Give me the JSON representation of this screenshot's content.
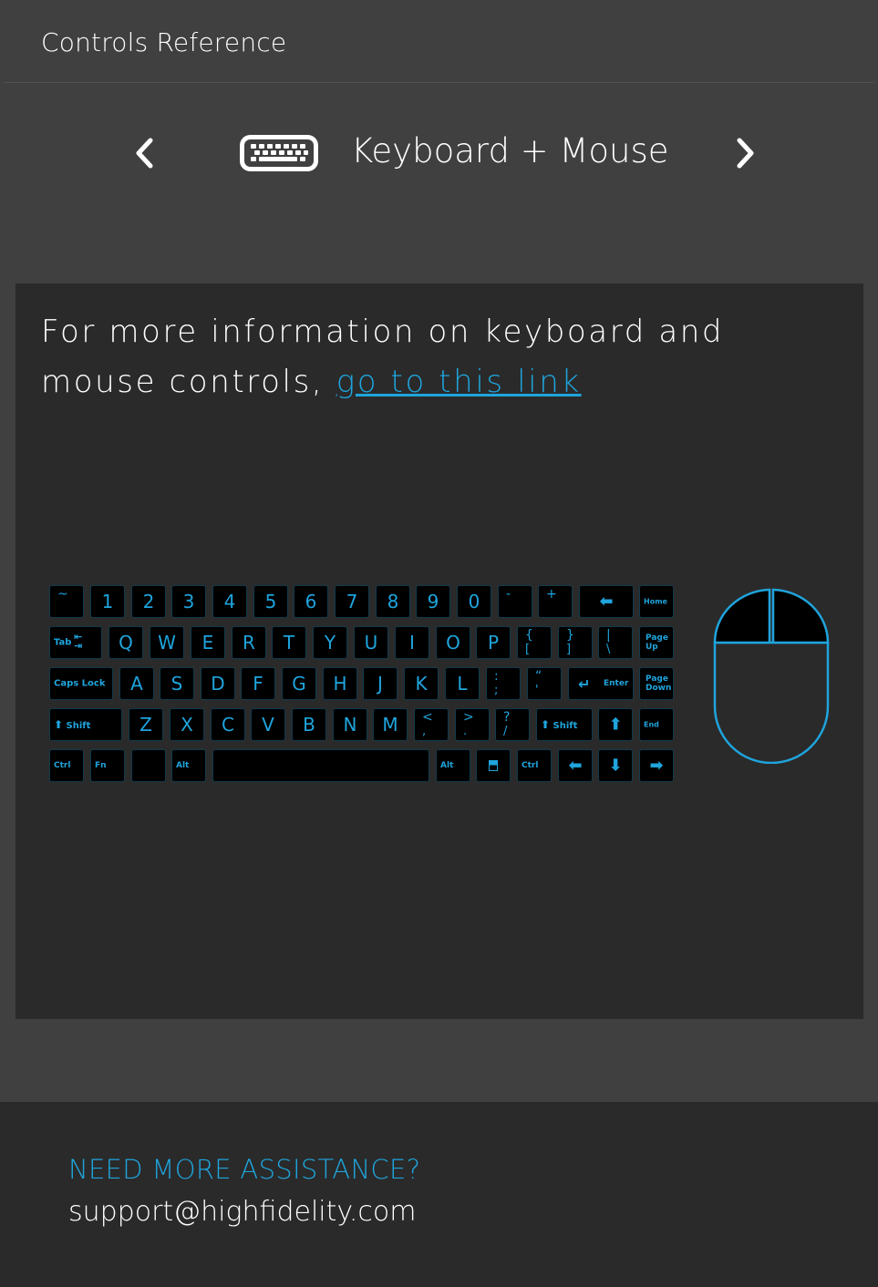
{
  "header": {
    "title": "Controls Reference"
  },
  "nav": {
    "prev_icon": "chevron-left-icon",
    "next_icon": "chevron-right-icon"
  },
  "scheme": {
    "icon": "keyboard-icon",
    "title": "Keyboard + Mouse"
  },
  "info": {
    "text": "For more information on keyboard and mouse controls, ",
    "link_text": "go to this link"
  },
  "keyboard": {
    "accent_color": "#1fa4dc",
    "keys": {
      "tilde": "~",
      "n1": "1",
      "n2": "2",
      "n3": "3",
      "n4": "4",
      "n5": "5",
      "n6": "6",
      "n7": "7",
      "n8": "8",
      "n9": "9",
      "n0": "0",
      "minus": "-",
      "plus": "+",
      "home": "Home",
      "tab": "Tab",
      "q": "Q",
      "w": "W",
      "e": "E",
      "r": "R",
      "t": "T",
      "y": "Y",
      "u": "U",
      "i": "I",
      "o": "O",
      "p": "P",
      "lbrace_top": "{",
      "lbrace_bot": "[",
      "rbrace_top": "}",
      "rbrace_bot": "]",
      "pipe_top": "|",
      "pipe_bot": "\\",
      "pageup_1": "Page",
      "pageup_2": "Up",
      "capslock": "Caps Lock",
      "a": "A",
      "s": "S",
      "d": "D",
      "f": "F",
      "g": "G",
      "h": "H",
      "j": "J",
      "k": "K",
      "l": "L",
      "colon_top": ":",
      "colon_bot": ";",
      "quote_top": "“",
      "quote_bot": "'",
      "enter": "Enter",
      "pagedown_1": "Page",
      "pagedown_2": "Down",
      "shift_l": "Shift",
      "z": "Z",
      "x": "X",
      "c": "C",
      "v": "V",
      "b": "B",
      "n": "N",
      "m": "M",
      "lt_top": "<",
      "lt_bot": ",",
      "gt_top": ">",
      "gt_bot": ".",
      "q_top": "?",
      "q_bot": "/",
      "shift_r": "Shift",
      "end": "End",
      "ctrl_l": "Ctrl",
      "fn": "Fn",
      "alt_l": "Alt",
      "alt_r": "Alt",
      "ctrl_r": "Ctrl"
    }
  },
  "footer": {
    "heading": "NEED MORE ASSISTANCE?",
    "email": "support@highfidelity.com"
  }
}
